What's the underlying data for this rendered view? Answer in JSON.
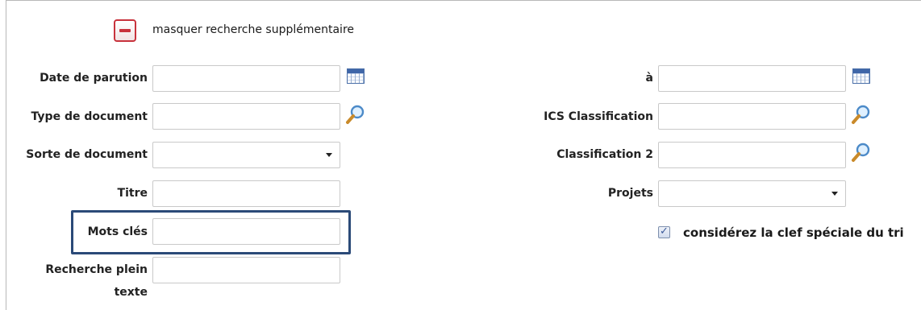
{
  "toggle": {
    "label": "masquer recherche supplémentaire"
  },
  "left": {
    "date": {
      "label": "Date de parution",
      "value": ""
    },
    "doc_type": {
      "label": "Type de document",
      "value": ""
    },
    "doc_sort": {
      "label": "Sorte de document",
      "selected": ""
    },
    "title": {
      "label": "Titre",
      "value": ""
    },
    "keywords": {
      "label": "Mots clés",
      "value": ""
    },
    "fulltext": {
      "label_line1": "Recherche plein",
      "label_line2": "texte",
      "value": ""
    }
  },
  "right": {
    "date_to": {
      "label": "à",
      "value": ""
    },
    "ics": {
      "label": "ICS Classification",
      "value": ""
    },
    "class2": {
      "label": "Classification 2",
      "value": ""
    },
    "projects": {
      "label": "Projets",
      "selected": ""
    },
    "special_key": {
      "label": "considérez la clef spéciale du tri",
      "checked": true
    }
  },
  "icons": {
    "calendar": "calendar-icon",
    "search": "magnifier-icon",
    "collapse": "minus-icon"
  },
  "colors": {
    "accent_red": "#c8323c",
    "highlight_border": "#2b4a78"
  }
}
